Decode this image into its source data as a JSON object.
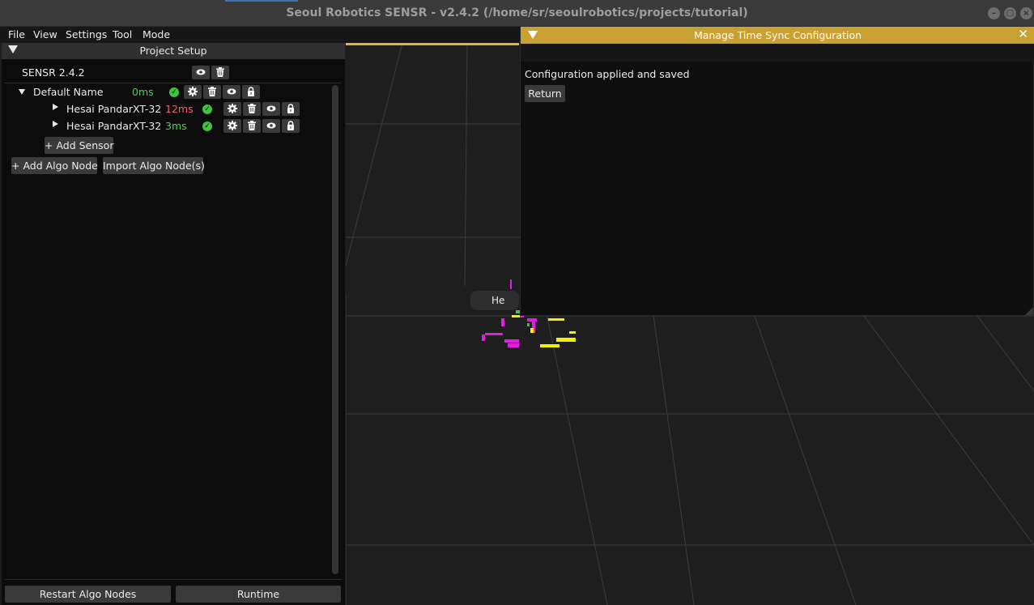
{
  "window": {
    "title": "Seoul Robotics SENSR - v2.4.2 (/home/sr/seoulrobotics/projects/tutorial)"
  },
  "menu": [
    "File",
    "View",
    "Settings",
    "Tool",
    "Mode"
  ],
  "project_setup": {
    "title": "Project Setup",
    "version_label": "SENSR 2.4.2",
    "group": {
      "name": "Default Name",
      "latency": "0ms",
      "sensors": [
        {
          "name": "Hesai PandarXT-32",
          "latency": "12ms",
          "latency_color": "#f06464"
        },
        {
          "name": "Hesai PandarXT-32",
          "latency": "3ms",
          "latency_color": "#4fd24f"
        }
      ],
      "add_sensor_label": "+ Add Sensor"
    },
    "add_algo_node_label": "+ Add Algo Node",
    "import_algo_node_label": "Import Algo Node(s)",
    "restart_algo_nodes_label": "Restart Algo Nodes",
    "runtime_label": "Runtime"
  },
  "viewport": {
    "hover_text": "Hе"
  },
  "modal": {
    "title": "Manage Time Sync Configuration",
    "message": "Configuration applied and saved",
    "return_label": "Return"
  },
  "colors": {
    "accent_yellow": "#c9a032",
    "status_green": "#4fd24f",
    "status_red": "#f06464",
    "point_magenta": "#e01ee0",
    "point_yellow": "#f0f000"
  }
}
